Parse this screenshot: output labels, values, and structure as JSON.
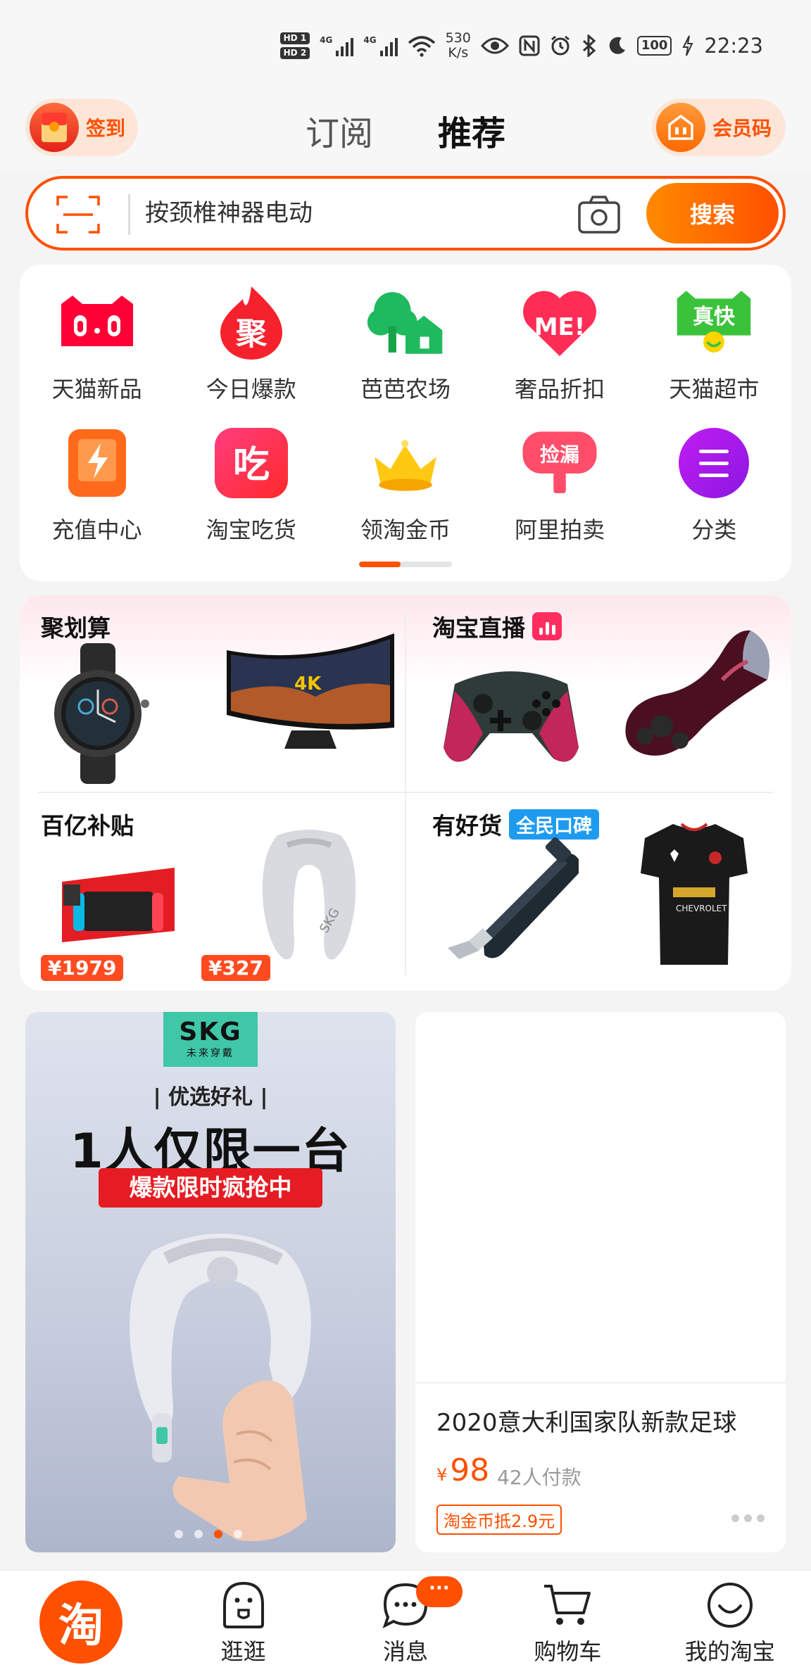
{
  "status_bar": {
    "hd1": "HD 1",
    "hd2": "HD 2",
    "signal1": "4G",
    "signal2": "4G",
    "speed_value": "530",
    "speed_unit": "K/s",
    "battery": "100",
    "time": "22:23"
  },
  "header": {
    "checkin_label": "签到",
    "member_code_label": "会员码",
    "tabs": [
      "订阅",
      "推荐"
    ],
    "active_tab": "推荐"
  },
  "search": {
    "placeholder": "按颈椎神器电动",
    "button_label": "搜索"
  },
  "categories": [
    {
      "label": "天猫新品",
      "icon": "tmall-cat-icon"
    },
    {
      "label": "今日爆款",
      "icon": "ju-flame-icon",
      "glyph": "聚"
    },
    {
      "label": "芭芭农场",
      "icon": "farm-tree-icon"
    },
    {
      "label": "奢品折扣",
      "icon": "me-heart-icon",
      "glyph": "ME!"
    },
    {
      "label": "天猫超市",
      "icon": "tmall-supermarket-icon",
      "glyph": "真快"
    },
    {
      "label": "充值中心",
      "icon": "recharge-icon"
    },
    {
      "label": "淘宝吃货",
      "icon": "food-icon",
      "glyph": "吃"
    },
    {
      "label": "领淘金币",
      "icon": "gold-crown-icon"
    },
    {
      "label": "阿里拍卖",
      "icon": "auction-icon",
      "glyph": "捡漏"
    },
    {
      "label": "分类",
      "icon": "menu-icon"
    }
  ],
  "category_page_progress": 0.45,
  "promos": {
    "juhuasuan": {
      "title": "聚划算",
      "tv_label": "4K"
    },
    "live": {
      "title": "淘宝直播"
    },
    "subsidy": {
      "title": "百亿补贴",
      "price1": "¥1979",
      "price2": "¥327"
    },
    "good_goods": {
      "title": "有好货",
      "tag": "全民口碑"
    }
  },
  "ad": {
    "brand": "SKG",
    "brand_sub": "未来穿戴",
    "tagline": "| 优选好礼 |",
    "headline": "1人仅限一台",
    "banner": "爆款限时疯抢中",
    "active_slide": 2
  },
  "feed_item": {
    "title": "2020意大利国家队新款足球",
    "currency": "¥",
    "price": "98",
    "sales": "42人付款",
    "badge": "淘金币抵2.9元"
  },
  "bottom_nav": {
    "home_glyph": "淘",
    "items": [
      "逛逛",
      "消息",
      "购物车",
      "我的淘宝"
    ],
    "message_badge": "···"
  },
  "colors": {
    "brand_orange": "#ff5000",
    "price_red": "#ff4b1f",
    "live_pink": "#ff2e5f",
    "tag_blue": "#1e9bf0"
  }
}
